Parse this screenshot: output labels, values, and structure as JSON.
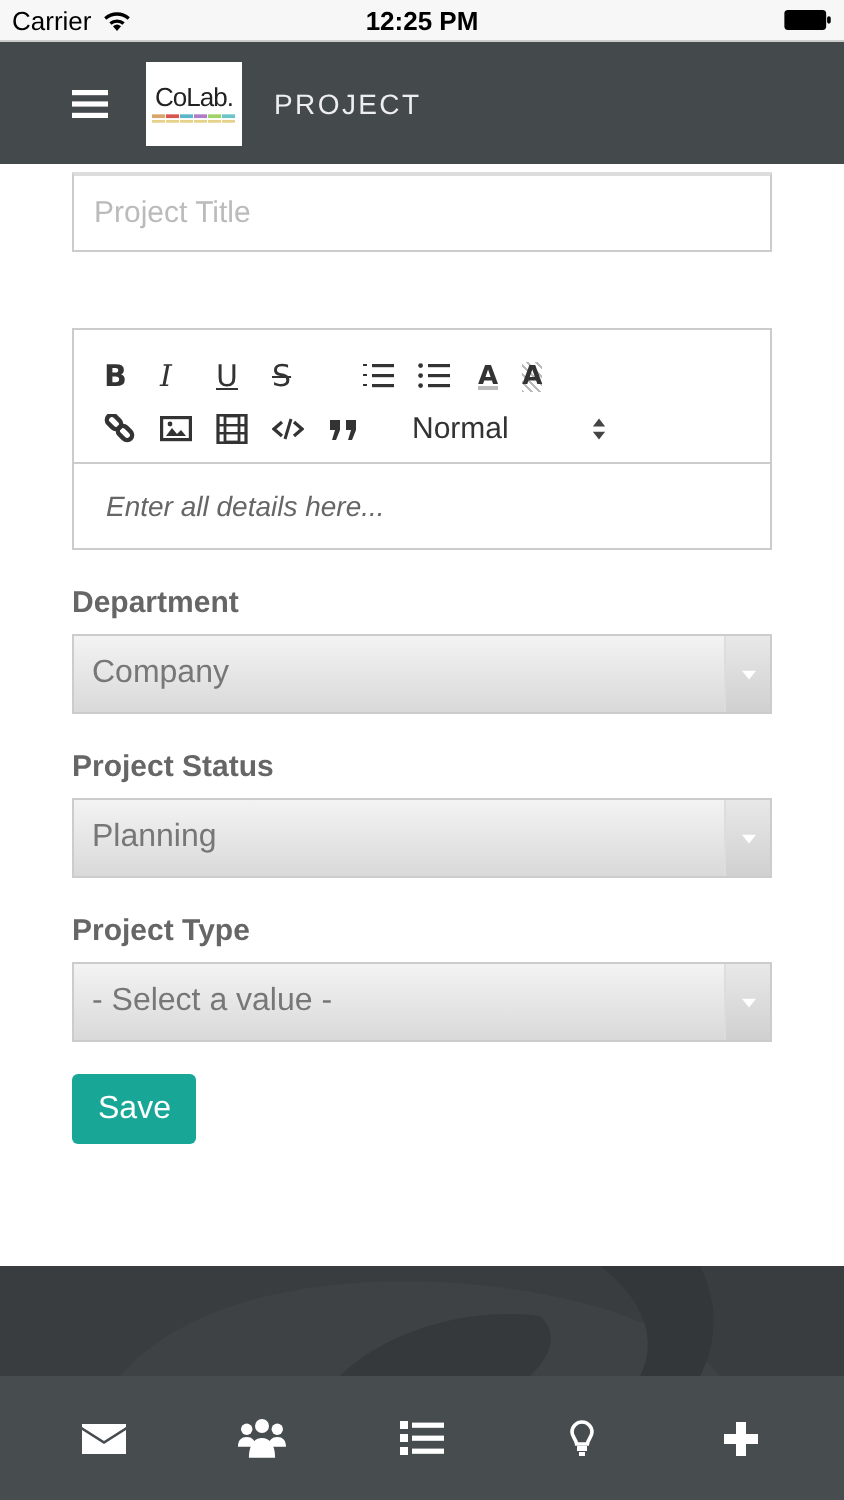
{
  "status_bar": {
    "carrier": "Carrier",
    "time": "12:25 PM"
  },
  "header": {
    "logo": "CoLab.",
    "title": "PROJECT"
  },
  "title_field": {
    "placeholder": "Project Title"
  },
  "editor": {
    "toolbar_rows": [
      [
        {
          "kind": "bold",
          "label": "B"
        },
        {
          "kind": "italic",
          "label": "I"
        },
        {
          "kind": "underline",
          "label": "U"
        },
        {
          "kind": "strike",
          "label": "S"
        },
        {
          "kind": "ordered-list"
        },
        {
          "kind": "bullet-list"
        },
        {
          "kind": "text-color",
          "label": "A"
        },
        {
          "kind": "background-color",
          "label": "A"
        }
      ],
      [
        {
          "kind": "link"
        },
        {
          "kind": "image"
        },
        {
          "kind": "video"
        },
        {
          "kind": "code"
        },
        {
          "kind": "quote"
        },
        {
          "kind": "format",
          "label": "Normal"
        }
      ]
    ],
    "placeholder": "Enter all details here..."
  },
  "selects": [
    {
      "label": "Department",
      "value": "Company"
    },
    {
      "label": "Project Status",
      "value": "Planning"
    },
    {
      "label": "Project Type",
      "value": "- Select a value -"
    }
  ],
  "save_button": "Save",
  "nav": [
    {
      "kind": "mail"
    },
    {
      "kind": "people"
    },
    {
      "kind": "numbered-list"
    },
    {
      "kind": "lightbulb"
    },
    {
      "kind": "plus"
    }
  ]
}
